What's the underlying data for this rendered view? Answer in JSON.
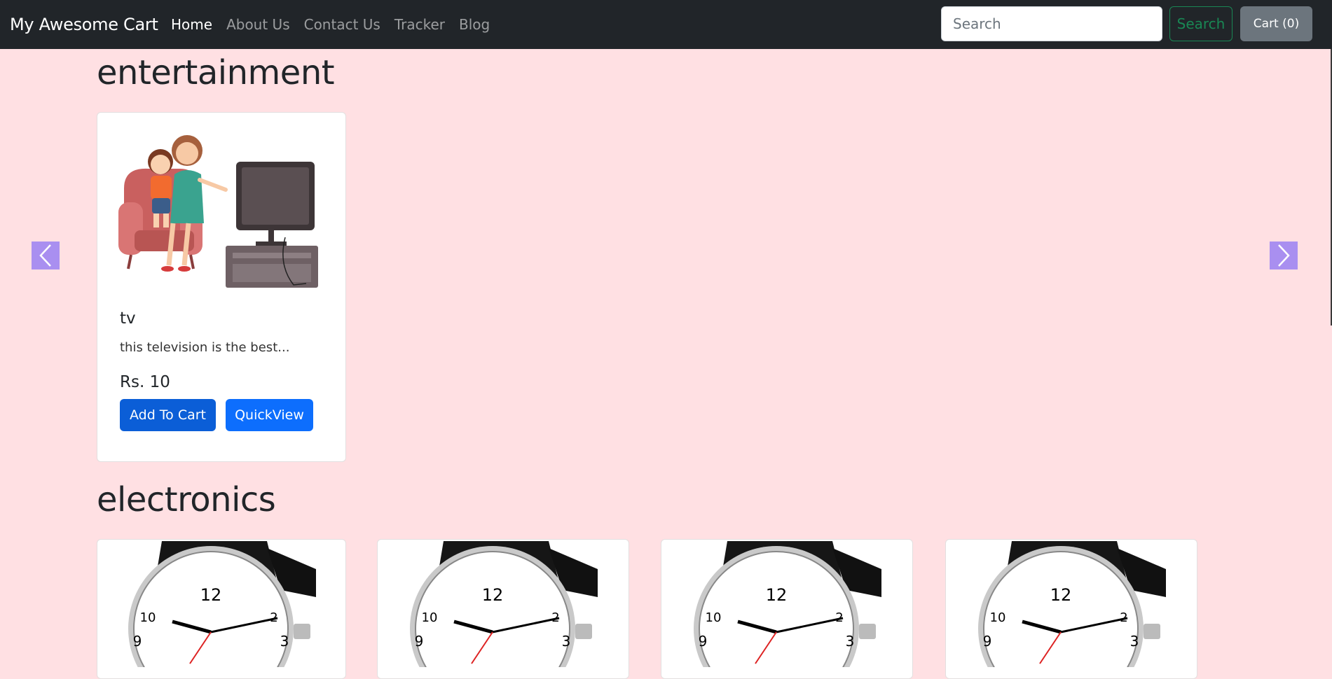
{
  "navbar": {
    "brand": "My Awesome Cart",
    "links": [
      {
        "label": "Home",
        "active": true
      },
      {
        "label": "About Us",
        "active": false
      },
      {
        "label": "Contact Us",
        "active": false
      },
      {
        "label": "Tracker",
        "active": false
      },
      {
        "label": "Blog",
        "active": false
      }
    ],
    "search_placeholder": "Search",
    "search_button": "Search",
    "cart_button": "Cart (0)"
  },
  "sections": [
    {
      "title": "entertainment",
      "products": [
        {
          "image": "tv-illustration",
          "name": "tv",
          "description": "this television is the best...",
          "price": "Rs. 10",
          "add_to_cart": "Add To Cart",
          "quick_view": "QuickView"
        }
      ]
    },
    {
      "title": "electronics",
      "products": [
        {
          "image": "wristwatch"
        },
        {
          "image": "wristwatch"
        },
        {
          "image": "wristwatch"
        },
        {
          "image": "wristwatch"
        }
      ]
    }
  ],
  "carousel": {
    "prev_icon": "chevron-left-icon",
    "next_icon": "chevron-right-icon",
    "arrow_color": "#a98ff0"
  },
  "colors": {
    "navbar": "#212529",
    "page_background": "#ffe0e3",
    "primary": "#0d6efd",
    "success": "#198754",
    "secondary": "#6c757d"
  }
}
